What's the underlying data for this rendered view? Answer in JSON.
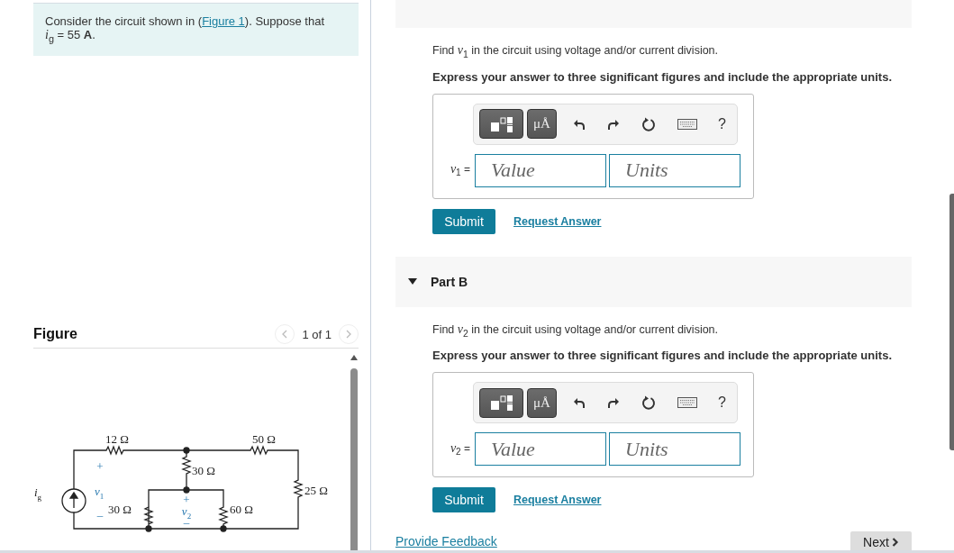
{
  "intro": {
    "before": "Consider the circuit shown in (",
    "link": "Figure 1",
    "after": "). Suppose that *i*$_{g}$ = 55 **A**."
  },
  "figure": {
    "heading": "Figure",
    "pager": "1 of 1",
    "prev_disabled": true,
    "next_disabled": true,
    "labels": [
      {
        "kind": "resistance",
        "text": "12 Ω"
      },
      {
        "kind": "resistance",
        "text": "50 Ω"
      },
      {
        "kind": "sign",
        "text": "+"
      },
      {
        "kind": "resistance",
        "text": "30 Ω"
      },
      {
        "kind": "source",
        "text": "*i*$_{g}$"
      },
      {
        "kind": "variable",
        "text": "*v*$_{1}$"
      },
      {
        "kind": "resistance",
        "text": "25 Ω"
      },
      {
        "kind": "sign",
        "text": "+"
      },
      {
        "kind": "resistance",
        "text": "30 Ω"
      },
      {
        "kind": "variable",
        "text": "*v*$_{2}$"
      },
      {
        "kind": "resistance",
        "text": "60 Ω"
      },
      {
        "kind": "sign",
        "text": "–"
      },
      {
        "kind": "sign",
        "text": "–"
      }
    ]
  },
  "parts": [
    {
      "expanded": true,
      "question": "Find *v*$_{1}$ in the circuit using voltage and/or current division.",
      "instruction": "Express your answer to three significant figures and include the appropriate units.",
      "toolbar": {
        "units_button": "μÅ",
        "help": "?"
      },
      "variable": "*v*$_{1}$ =",
      "value_placeholder": "Value",
      "units_placeholder": "Units",
      "submit": "Submit",
      "request": "Request Answer"
    },
    {
      "title": "Part B",
      "expanded": true,
      "question": "Find *v*$_{2}$ in the circuit using voltage and/or current division.",
      "instruction": "Express your answer to three significant figures and include the appropriate units.",
      "toolbar": {
        "units_button": "μÅ",
        "help": "?"
      },
      "variable": "*v*$_{2}$ =",
      "value_placeholder": "Value",
      "units_placeholder": "Units",
      "submit": "Submit",
      "request": "Request Answer"
    }
  ],
  "feedback_link": "Provide Feedback",
  "next_button": "Next"
}
